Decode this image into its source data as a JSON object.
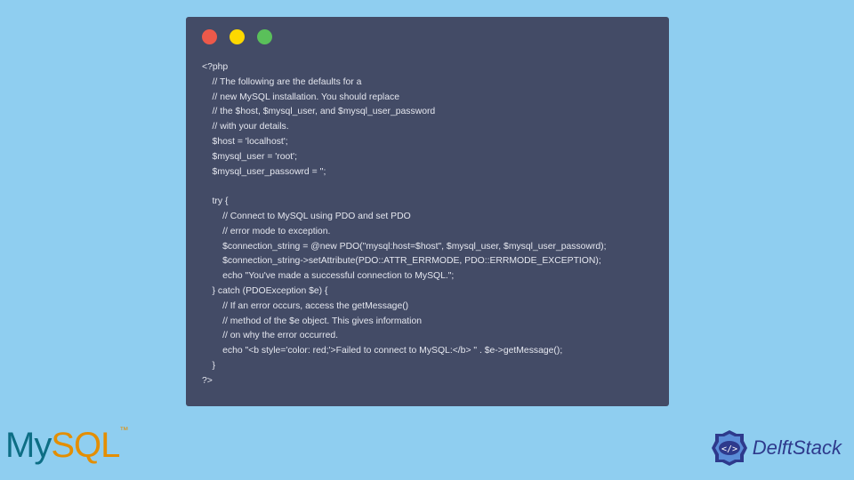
{
  "code": {
    "lines": [
      "<?php",
      "    // The following are the defaults for a",
      "    // new MySQL installation. You should replace",
      "    // the $host, $mysql_user, and $mysql_user_password",
      "    // with your details.",
      "    $host = 'localhost';",
      "    $mysql_user = 'root';",
      "    $mysql_user_passowrd = '';",
      "",
      "    try {",
      "        // Connect to MySQL using PDO and set PDO",
      "        // error mode to exception.",
      "        $connection_string = @new PDO(\"mysql:host=$host\", $mysql_user, $mysql_user_passowrd);",
      "        $connection_string->setAttribute(PDO::ATTR_ERRMODE, PDO::ERRMODE_EXCEPTION);",
      "        echo \"You've made a successful connection to MySQL.\";",
      "    } catch (PDOException $e) {",
      "        // If an error occurs, access the getMessage()",
      "        // method of the $e object. This gives information",
      "        // on why the error occurred.",
      "        echo \"<b style='color: red;'>Failed to connect to MySQL:</b> \" . $e->getMessage();",
      "    }",
      "?>"
    ]
  },
  "logos": {
    "mysql_my": "My",
    "mysql_sql": "SQL",
    "mysql_tm": "™",
    "delft": "DelftStack"
  },
  "colors": {
    "background": "#8fcef0",
    "window": "#434b66"
  }
}
